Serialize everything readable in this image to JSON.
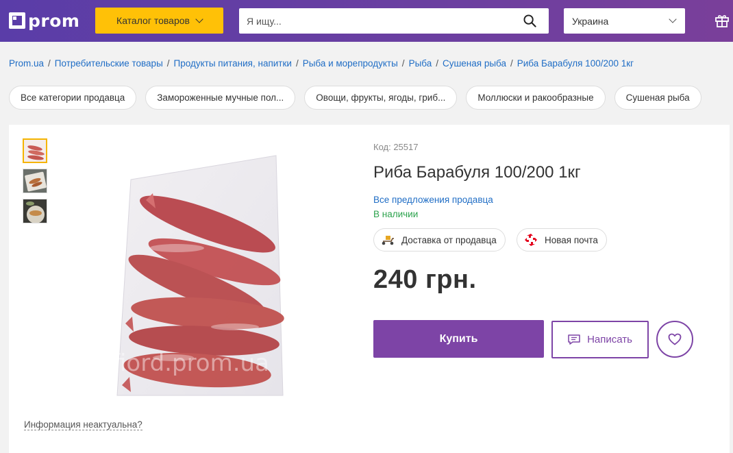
{
  "header": {
    "logo_text": "prom",
    "catalog_label": "Каталог товаров",
    "search_placeholder": "Я ищу...",
    "region": "Украина"
  },
  "breadcrumb": [
    "Prom.ua",
    "Потребительские товары",
    "Продукты питания, напитки",
    "Рыба и морепродукты",
    "Рыба",
    "Сушеная рыба",
    "Риба Барабуля 100/200 1кг"
  ],
  "chips": [
    "Все категории продавца",
    "Замороженные мучные пол...",
    "Овощи, фрукты, ягоды, гриб...",
    "Моллюски и ракообразные",
    "Сушеная рыба"
  ],
  "product": {
    "code": "Код: 25517",
    "title": "Риба Барабуля 100/200 1кг",
    "seller_offers": "Все предложения продавца",
    "stock": "В наличии",
    "delivery_seller": "Доставка от продавца",
    "delivery_np": "Новая почта",
    "price": "240 грн.",
    "buy_label": "Купить",
    "write_label": "Написать",
    "info_outdated": "Информация неактуальна?",
    "watermark": "fiord.prom.ua"
  },
  "colors": {
    "header": "#5a3da8",
    "accent_yellow": "#ffc107",
    "purple": "#7d44a6",
    "link": "#1f6dc5",
    "in_stock": "#2ba24c",
    "nova_poshta": "#e3001b"
  },
  "icons": [
    "search-icon",
    "chevron-down-icon",
    "gift-icon",
    "scooter-icon",
    "nova-poshta-icon",
    "message-icon",
    "heart-icon"
  ]
}
